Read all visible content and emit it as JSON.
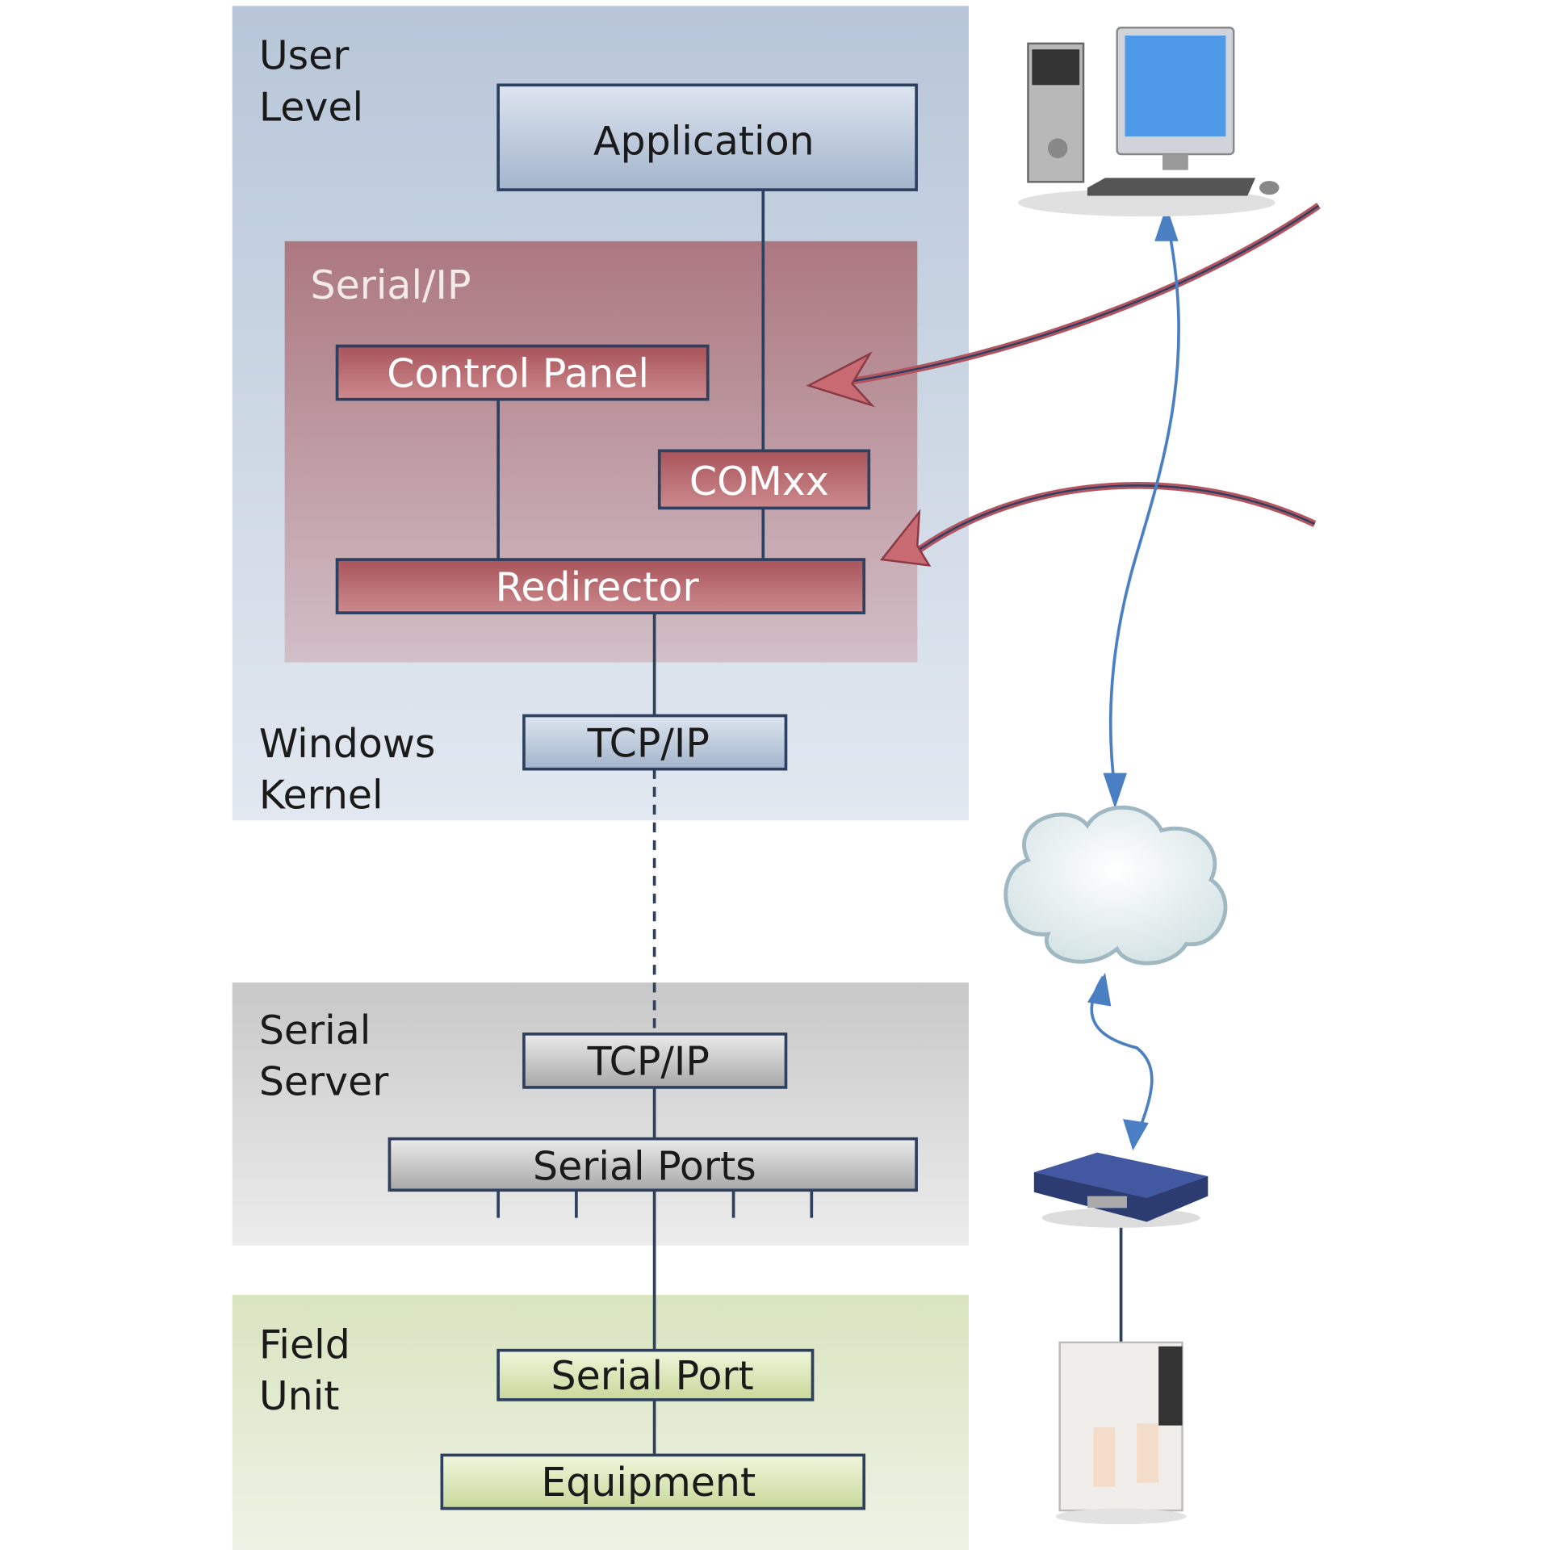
{
  "layers": {
    "user_level": [
      "User",
      "Level"
    ],
    "windows_kernel": [
      "Windows",
      "Kernel"
    ],
    "serial_server": [
      "Serial",
      "Server"
    ],
    "field_unit": [
      "Field",
      "Unit"
    ],
    "serial_ip": "Serial/IP"
  },
  "boxes": {
    "application": "Application",
    "control_panel": "Control Panel",
    "comxx": "COMxx",
    "redirector": "Redirector",
    "tcpip_pc": "TCP/IP",
    "tcpip_server": "TCP/IP",
    "serial_ports": "Serial Ports",
    "serial_port": "Serial Port",
    "equipment": "Equipment"
  },
  "icons": [
    "desktop-computer-icon",
    "cloud-icon",
    "serial-server-device-icon",
    "field-equipment-cabinet-icon"
  ],
  "colors": {
    "windows_bg": "#c3cfdd",
    "serial_ip_bg": "#b27a80",
    "server_bg": "#d2d2d2",
    "field_bg": "#dfe8c8",
    "line": "#2e4060",
    "network_arrow": "#4a7fc4"
  }
}
